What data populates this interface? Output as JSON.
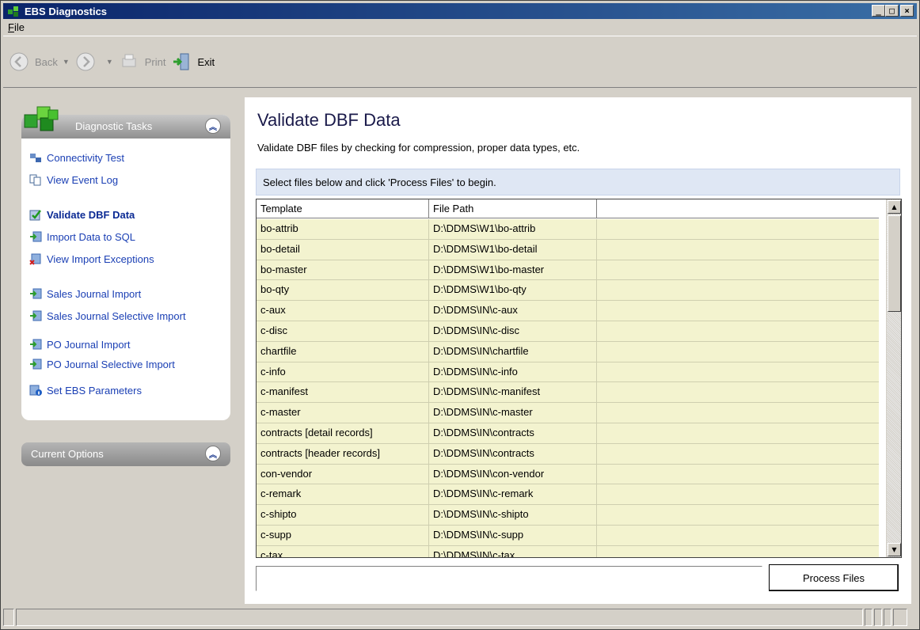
{
  "window": {
    "title": "EBS Diagnostics",
    "controls": {
      "minimize": "_",
      "maximize": "□",
      "close": "×"
    }
  },
  "menu": {
    "file_prefix": "F",
    "file_rest": "ile"
  },
  "toolbar": {
    "back_label": "Back",
    "print_label": "Print",
    "exit_label": "Exit"
  },
  "tasks": {
    "header": "Diagnostic Tasks",
    "items": [
      {
        "label": "Connectivity Test",
        "icon": "network-icon"
      },
      {
        "label": "View Event Log",
        "icon": "document-icon"
      },
      {
        "label": "Validate DBF Data",
        "icon": "validate-icon",
        "active": true
      },
      {
        "label": "Import Data to SQL",
        "icon": "import-icon"
      },
      {
        "label": "View Import Exceptions",
        "icon": "exceptions-icon"
      },
      {
        "label": "Sales Journal Import",
        "icon": "import-icon"
      },
      {
        "label": "Sales Journal Selective Import",
        "icon": "import-icon"
      },
      {
        "label": "PO Journal Import",
        "icon": "import-icon"
      },
      {
        "label": "PO Journal Selective Import",
        "icon": "import-icon"
      },
      {
        "label": "Set EBS Parameters",
        "icon": "parameters-icon"
      }
    ]
  },
  "options": {
    "header": "Current Options"
  },
  "page": {
    "title": "Validate DBF Data",
    "description": "Validate DBF files by checking for compression, proper data types, etc.",
    "instruction": "Select files below and click 'Process Files' to begin."
  },
  "grid": {
    "columns": [
      "Template",
      "File Path",
      ""
    ],
    "rows": [
      [
        "bo-attrib",
        "D:\\DDMS\\W1\\bo-attrib"
      ],
      [
        "bo-detail",
        "D:\\DDMS\\W1\\bo-detail"
      ],
      [
        "bo-master",
        "D:\\DDMS\\W1\\bo-master"
      ],
      [
        "bo-qty",
        "D:\\DDMS\\W1\\bo-qty"
      ],
      [
        "c-aux",
        "D:\\DDMS\\IN\\c-aux"
      ],
      [
        "c-disc",
        "D:\\DDMS\\IN\\c-disc"
      ],
      [
        "chartfile",
        "D:\\DDMS\\IN\\chartfile"
      ],
      [
        "c-info",
        "D:\\DDMS\\IN\\c-info"
      ],
      [
        "c-manifest",
        "D:\\DDMS\\IN\\c-manifest"
      ],
      [
        "c-master",
        "D:\\DDMS\\IN\\c-master"
      ],
      [
        "contracts [detail records]",
        "D:\\DDMS\\IN\\contracts"
      ],
      [
        "contracts [header records]",
        "D:\\DDMS\\IN\\contracts"
      ],
      [
        "con-vendor",
        "D:\\DDMS\\IN\\con-vendor"
      ],
      [
        "c-remark",
        "D:\\DDMS\\IN\\c-remark"
      ],
      [
        "c-shipto",
        "D:\\DDMS\\IN\\c-shipto"
      ],
      [
        "c-supp",
        "D:\\DDMS\\IN\\c-supp"
      ],
      [
        "c-tax",
        "D:\\DDMS\\IN\\c-tax"
      ]
    ]
  },
  "actions": {
    "process_label": "Process Files"
  },
  "colors": {
    "title_bar_start": "#0a246a",
    "title_bar_end": "#3a6ea5",
    "link": "#1a3fb4",
    "row_background": "#f3f3cf",
    "info_bar": "#dfe7f4"
  }
}
